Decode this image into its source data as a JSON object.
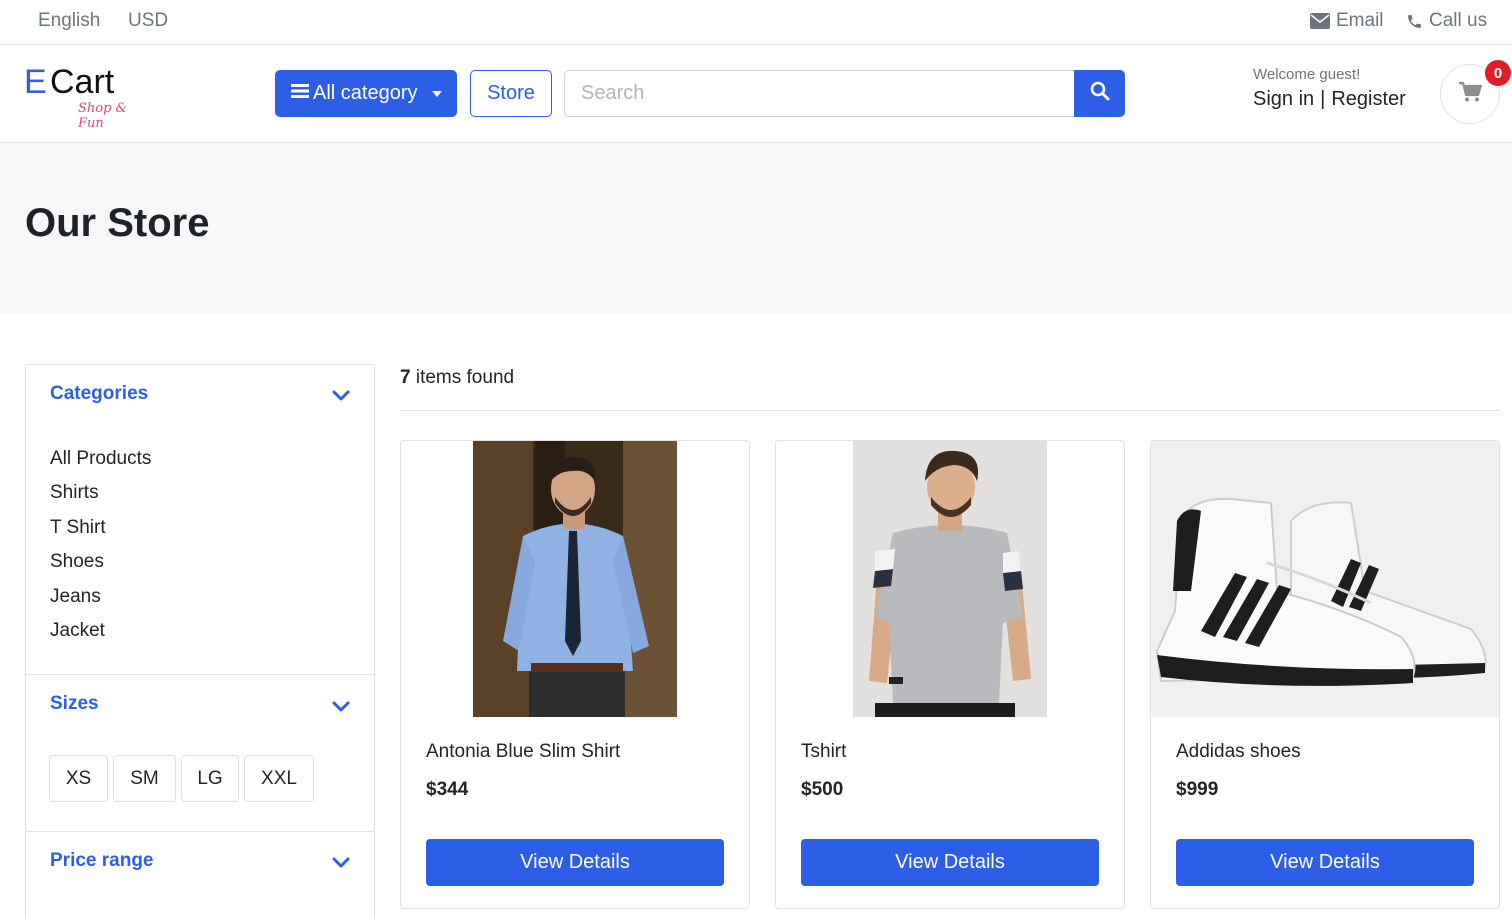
{
  "topbar": {
    "language": "English",
    "currency": "USD",
    "email_label": "Email",
    "call_label": "Call us"
  },
  "header": {
    "logo_letter": "E",
    "logo_text": "Cart",
    "logo_tagline": "Shop & Fun",
    "category_button": "All category",
    "store_button": "Store",
    "search_placeholder": "Search",
    "welcome": "Welcome guest!",
    "sign_in": "Sign in",
    "separator": "|",
    "register": "Register",
    "cart_count": "0"
  },
  "banner": {
    "title": "Our Store"
  },
  "sidebar": {
    "categories_title": "Categories",
    "categories": [
      "All Products",
      "Shirts",
      "T Shirt",
      "Shoes",
      "Jeans",
      "Jacket"
    ],
    "sizes_title": "Sizes",
    "sizes": [
      "XS",
      "SM",
      "LG",
      "XXL"
    ],
    "price_title": "Price range"
  },
  "results": {
    "count": "7",
    "count_suffix": "items found"
  },
  "products": [
    {
      "name": "Antonia Blue Slim Shirt",
      "price": "$344",
      "button": "View Details"
    },
    {
      "name": "Tshirt",
      "price": "$500",
      "button": "View Details"
    },
    {
      "name": "Addidas shoes",
      "price": "$999",
      "button": "View Details"
    }
  ],
  "colors": {
    "accent": "#2c5ee8",
    "badge": "#e11d2a",
    "banner_bg": "#f6f7f9"
  }
}
